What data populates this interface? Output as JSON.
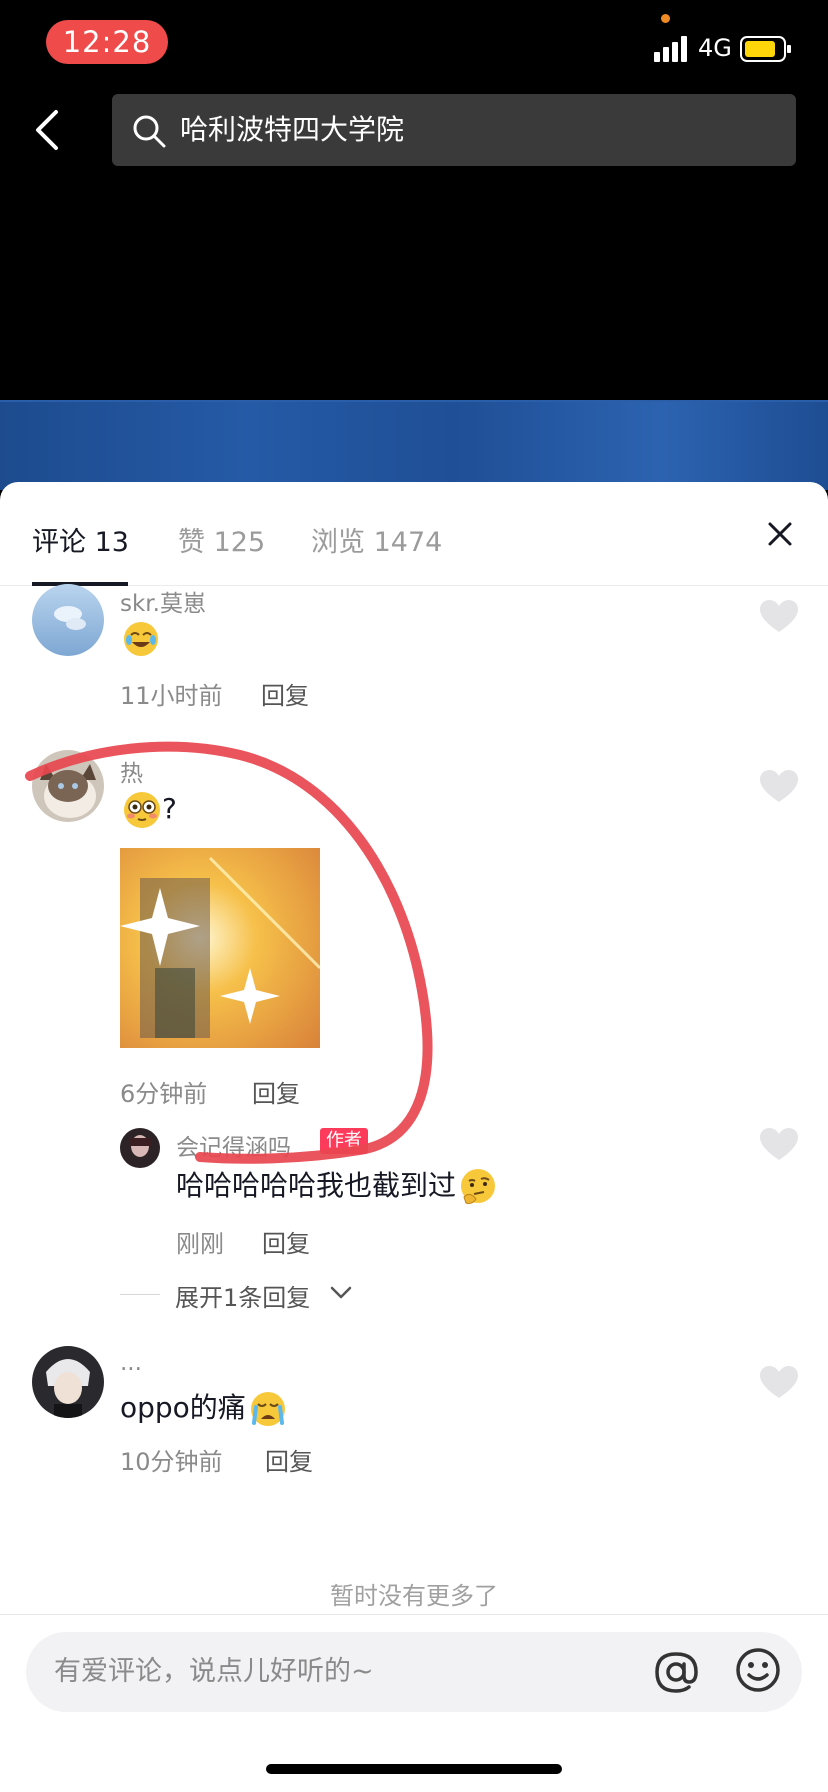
{
  "status_bar": {
    "time": "12:28",
    "network": "4G"
  },
  "search": {
    "query": "哈利波特四大学院"
  },
  "tabs": [
    {
      "label": "评论 13"
    },
    {
      "label": "赞 125"
    },
    {
      "label": "浏览 1474"
    }
  ],
  "comments": [
    {
      "user": "skr.莫崽",
      "text": "",
      "time": "11小时前",
      "reply": "回复"
    },
    {
      "user": "热",
      "text": "?",
      "time": "6分钟前",
      "reply": "回复"
    },
    {
      "user": "会记得涵吗",
      "badge": "作者",
      "text": "哈哈哈哈哈我也截到过",
      "time": "刚刚",
      "reply": "回复"
    },
    {
      "user": "...",
      "text": "oppo的痛",
      "time": "10分钟前",
      "reply": "回复"
    }
  ],
  "expand_replies": "展开1条回复",
  "no_more": "暂时没有更多了",
  "input": {
    "placeholder": "有爱评论，说点儿好听的~"
  },
  "colors": {
    "accent_red": "#ef4b4b",
    "author_badge": "#ff3b5c",
    "annotation_stroke": "#e8474f"
  }
}
